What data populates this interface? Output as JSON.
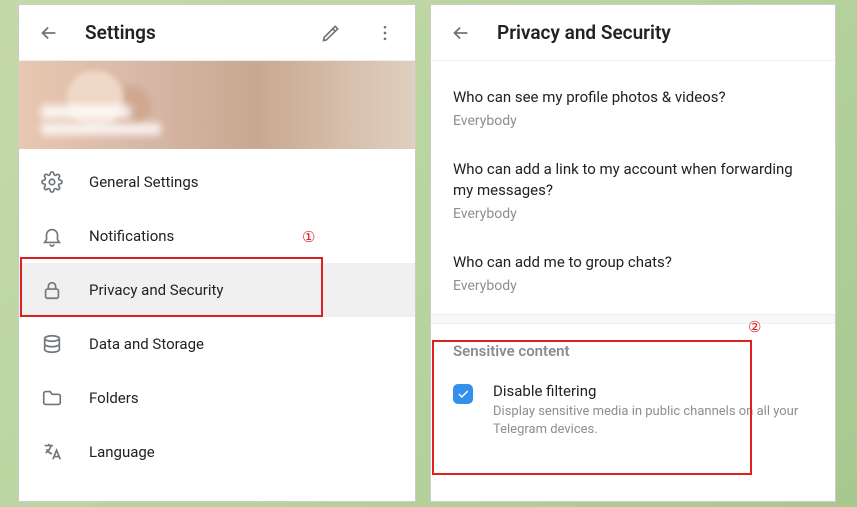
{
  "left": {
    "title": "Settings",
    "items": [
      {
        "icon": "gear",
        "label": "General Settings"
      },
      {
        "icon": "bell",
        "label": "Notifications"
      },
      {
        "icon": "lock",
        "label": "Privacy and Security"
      },
      {
        "icon": "disk",
        "label": "Data and Storage"
      },
      {
        "icon": "folder",
        "label": "Folders"
      },
      {
        "icon": "lang",
        "label": "Language"
      }
    ]
  },
  "right": {
    "title": "Privacy and Security",
    "rows": [
      {
        "q": "Who can see my profile photos & videos?",
        "a": "Everybody"
      },
      {
        "q": "Who can add a link to my account when forwarding my messages?",
        "a": "Everybody"
      },
      {
        "q": "Who can add me to group chats?",
        "a": "Everybody"
      }
    ],
    "section": "Sensitive content",
    "check": {
      "title": "Disable filtering",
      "desc": "Display sensitive media in public channels on all your Telegram devices.",
      "checked": true
    }
  },
  "annotations": {
    "label1": "①",
    "label2": "②"
  }
}
